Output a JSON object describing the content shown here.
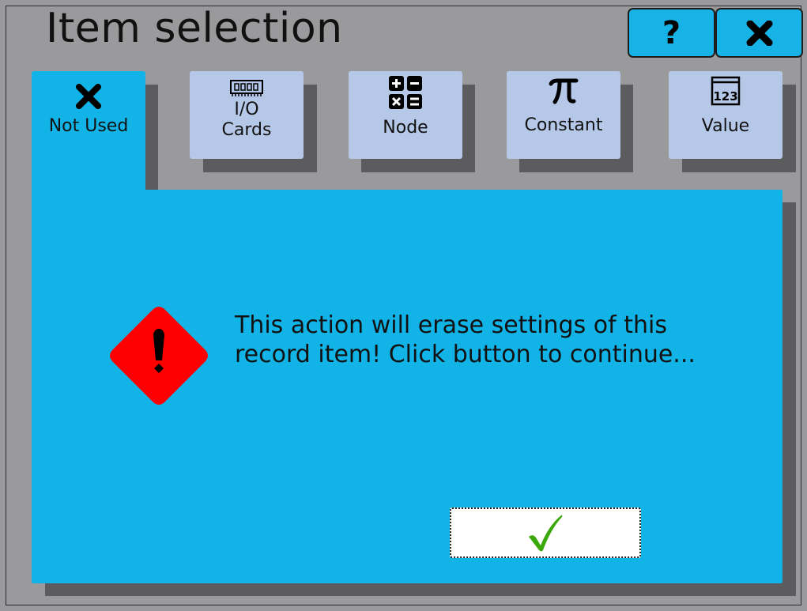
{
  "window": {
    "title": "Item selection",
    "help_label": "?",
    "help_icon": "question-icon",
    "close_icon": "close-x-icon"
  },
  "tabs": [
    {
      "label": "Not Used",
      "icon": "x-icon",
      "active": true
    },
    {
      "label": "I/O\nCards",
      "icon": "memory-card-icon",
      "active": false
    },
    {
      "label": "Node",
      "icon": "calculator-icon",
      "active": false
    },
    {
      "label": "Constant",
      "icon": "pi-icon",
      "active": false
    },
    {
      "label": "Value",
      "icon": "number-123-icon",
      "active": false
    }
  ],
  "dialog": {
    "message": "This action will erase settings of this record item! Click button to continue...",
    "warning_icon": "warning-diamond-icon",
    "confirm_icon": "checkmark-icon"
  },
  "colors": {
    "accent": "#12b4e8",
    "tab_inactive": "#b6c8e7",
    "background": "#9a999b",
    "warning": "#ff0000",
    "check": "#3aa80a"
  }
}
